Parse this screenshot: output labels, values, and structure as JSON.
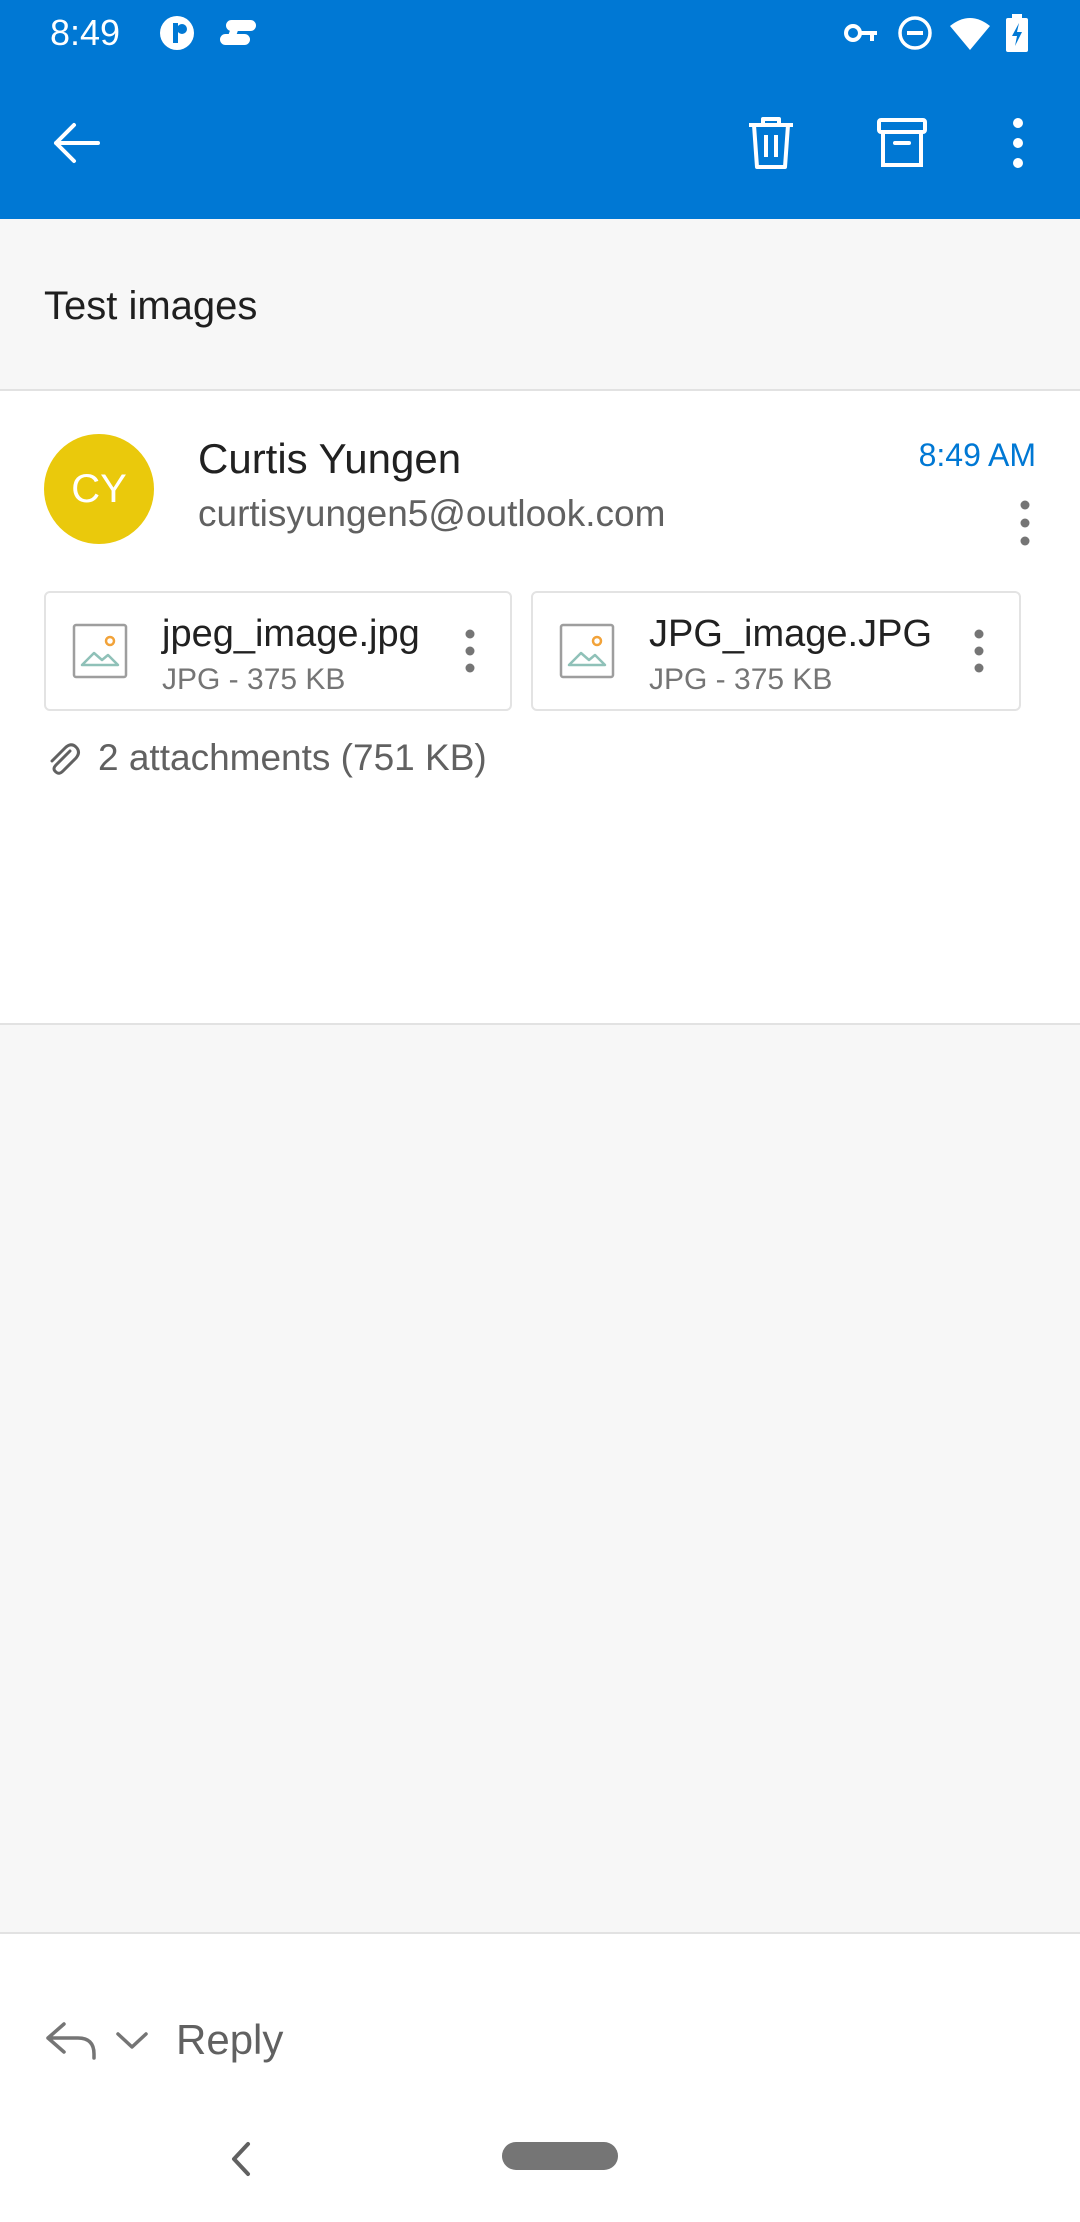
{
  "status_bar": {
    "time": "8:49"
  },
  "app_bar": {
    "back_icon": "arrow-left-icon",
    "delete_icon": "trash-icon",
    "archive_icon": "archive-icon",
    "more_icon": "more-vert-icon"
  },
  "subject": "Test images",
  "message": {
    "avatar_initials": "CY",
    "sender_name": "Curtis Yungen",
    "sender_email": "curtisyungen5@outlook.com",
    "time": "8:49 AM",
    "attachments": [
      {
        "name": "jpeg_image.jpg",
        "meta": "JPG - 375 KB"
      },
      {
        "name": "JPG_image.JPG",
        "meta": "JPG - 375 KB"
      }
    ],
    "attachments_summary": "2 attachments (751 KB)"
  },
  "reply": {
    "label": "Reply"
  },
  "colors": {
    "brand": "#0078d4",
    "avatar": "#eac90c"
  }
}
